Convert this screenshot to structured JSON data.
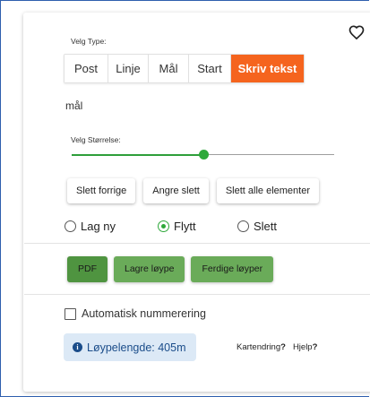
{
  "type_selector": {
    "label": "Velg Type:",
    "options": [
      "Post",
      "Linje",
      "Mål",
      "Start",
      "Skriv tekst"
    ],
    "selected": "Skriv tekst",
    "active_color": "#f5641e"
  },
  "selected_type_text": "mål",
  "size_slider": {
    "label": "Velg Størrelse:",
    "value_fraction": 0.5,
    "accent_color": "#2ea83a"
  },
  "action_buttons": {
    "delete_previous": "Slett forrige",
    "undo_delete": "Angre slett",
    "delete_all": "Slett alle elementer"
  },
  "mode_radios": {
    "options": [
      "Lag ny",
      "Flytt",
      "Slett"
    ],
    "selected": "Flytt"
  },
  "export_buttons": {
    "pdf": "PDF",
    "save_course": "Lagre løype",
    "finished_courses": "Ferdige løyper"
  },
  "auto_numbering": {
    "label": "Automatisk nummerering",
    "checked": false
  },
  "course_length": {
    "text": "Løypelengde: 405m"
  },
  "links": {
    "map_change": "Kartendring",
    "help": "Hjelp",
    "suffix": "?"
  },
  "icons": [
    "heart-icon",
    "info-icon"
  ]
}
